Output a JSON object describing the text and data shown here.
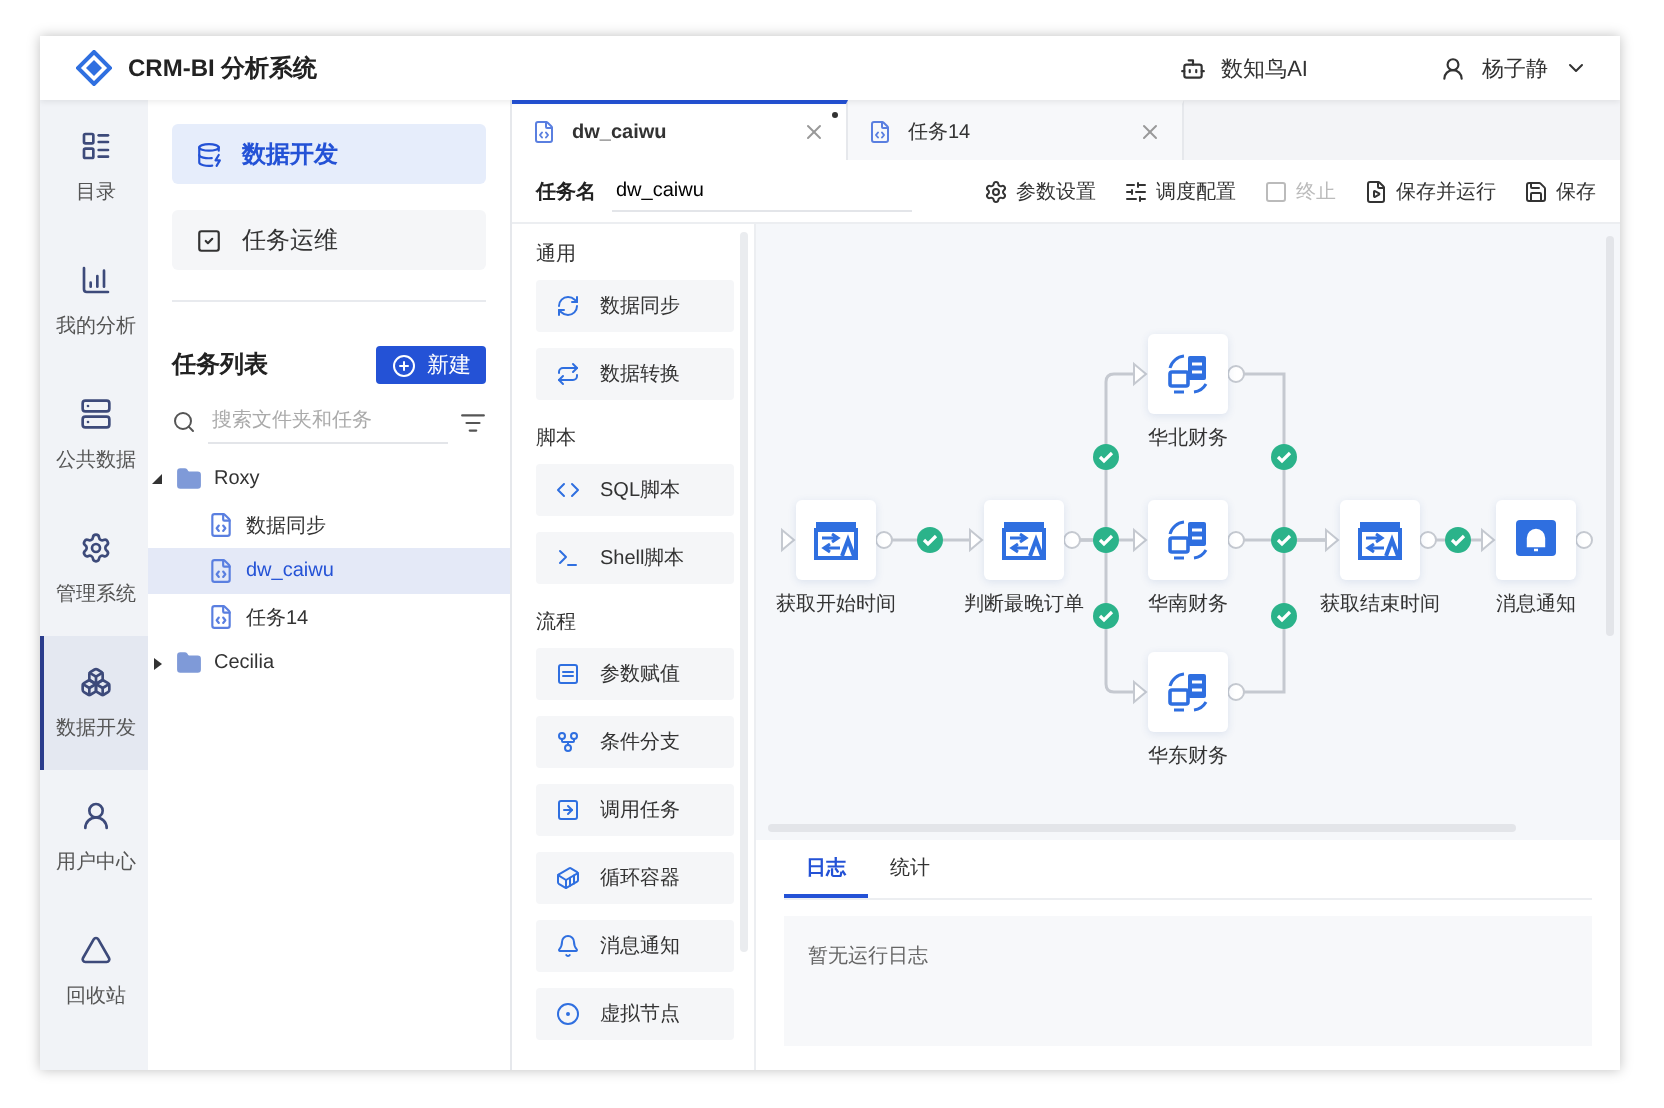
{
  "app": {
    "title": "CRM-BI 分析系统",
    "assistant": "数知鸟AI",
    "user": "杨子静"
  },
  "nav": [
    {
      "label": "目录",
      "selected": false
    },
    {
      "label": "我的分析",
      "selected": false
    },
    {
      "label": "公共数据",
      "selected": false
    },
    {
      "label": "管理系统",
      "selected": false
    },
    {
      "label": "数据开发",
      "selected": true
    },
    {
      "label": "用户中心",
      "selected": false
    },
    {
      "label": "回收站",
      "selected": false
    }
  ],
  "modules": [
    {
      "label": "数据开发",
      "selected": true
    },
    {
      "label": "任务运维",
      "selected": false
    }
  ],
  "task_list": {
    "title": "任务列表",
    "new_button": "新建",
    "search": {
      "placeholder": "搜索文件夹和任务"
    },
    "tree": [
      {
        "label": "Roxy",
        "expanded": true,
        "selected": false,
        "children": [
          {
            "label": "数据同步",
            "selected": false
          },
          {
            "label": "dw_caiwu",
            "selected": true
          },
          {
            "label": "任务14",
            "selected": false
          }
        ]
      },
      {
        "label": "Cecilia",
        "expanded": false,
        "selected": false
      }
    ]
  },
  "tabs": [
    {
      "label": "dw_caiwu",
      "selected": true,
      "modified": true
    },
    {
      "label": "任务14",
      "selected": false,
      "modified": false
    }
  ],
  "toolbar": {
    "name_label": "任务名",
    "name_value": "dw_caiwu",
    "actions": [
      {
        "label": "参数设置",
        "disabled": false
      },
      {
        "label": "调度配置",
        "disabled": false
      },
      {
        "label": "终止",
        "disabled": true
      },
      {
        "label": "保存并运行",
        "disabled": false
      },
      {
        "label": "保存",
        "disabled": false
      }
    ]
  },
  "palette": [
    {
      "group": "通用",
      "items": [
        "数据同步",
        "数据转换"
      ]
    },
    {
      "group": "脚本",
      "items": [
        "SQL脚本",
        "Shell脚本"
      ]
    },
    {
      "group": "流程",
      "items": [
        "参数赋值",
        "条件分支",
        "调用任务",
        "循环容器",
        "消息通知",
        "虚拟节点"
      ]
    }
  ],
  "flow": {
    "nodes": [
      {
        "label": "获取开始时间",
        "kind": "assign"
      },
      {
        "label": "判断最晚订单",
        "kind": "assign"
      },
      {
        "label": "华北财务",
        "kind": "sync"
      },
      {
        "label": "华南财务",
        "kind": "sync"
      },
      {
        "label": "华东财务",
        "kind": "sync"
      },
      {
        "label": "获取结束时间",
        "kind": "assign"
      },
      {
        "label": "消息通知",
        "kind": "notify"
      }
    ]
  },
  "log_panel": {
    "tabs": [
      {
        "label": "日志",
        "selected": true
      },
      {
        "label": "统计",
        "selected": false
      }
    ],
    "message": "暂无运行日志"
  }
}
